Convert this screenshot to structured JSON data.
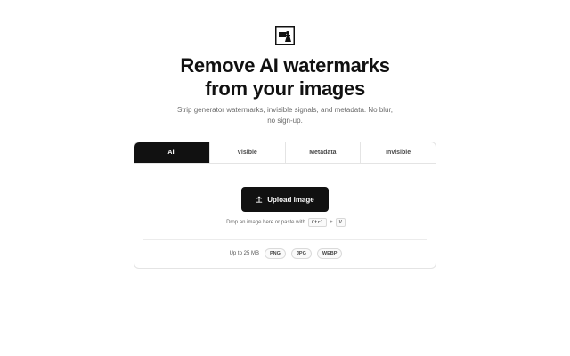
{
  "logo": {
    "icon": "watermark-remover-logo-icon"
  },
  "hero": {
    "title_line1": "Remove AI watermarks",
    "title_line2": "from your images",
    "subtitle_line1": "Strip generator watermarks, invisible signals, and metadata. No blur,",
    "subtitle_line2": "no sign-up."
  },
  "tabs": [
    {
      "label": "All",
      "active": true
    },
    {
      "label": "Visible",
      "active": false
    },
    {
      "label": "Metadata",
      "active": false
    },
    {
      "label": "Invisible",
      "active": false
    }
  ],
  "upload": {
    "button_label": "Upload image",
    "icon": "upload-icon",
    "hint_text": "Drop an image here or paste with",
    "key1": "Ctrl",
    "key_plus": "+",
    "key2": "V"
  },
  "limits": {
    "size_text": "Up to 25 MB",
    "formats": [
      "PNG",
      "JPG",
      "WEBP"
    ]
  },
  "colors": {
    "primary": "#111111",
    "border": "#e4e4e4",
    "muted_text": "#6b6b6b"
  }
}
